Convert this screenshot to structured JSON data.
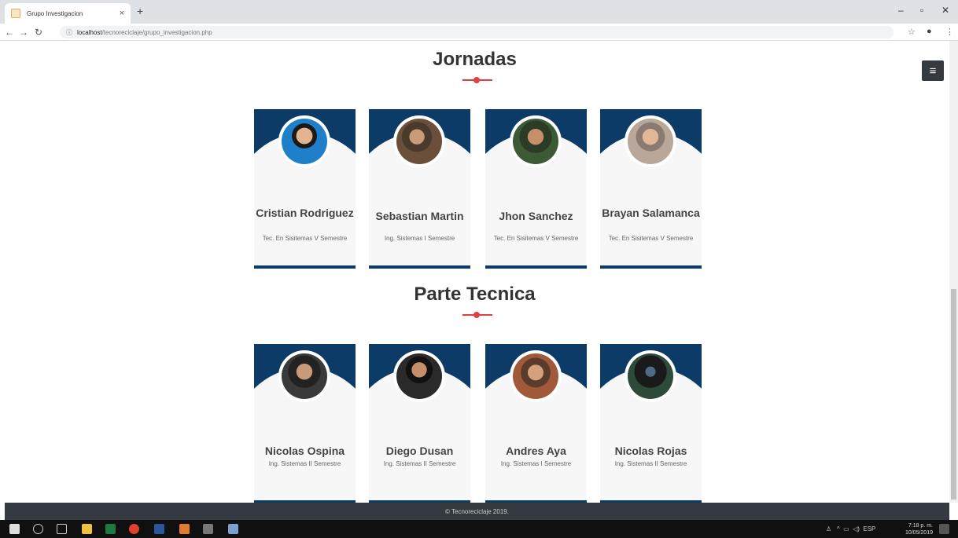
{
  "browser": {
    "tab_title": "Grupo Investigacion",
    "tab_close": "×",
    "new_tab": "+",
    "url_host": "localhost",
    "url_path": "/tecnoreciclaje/grupo_investigacion.php",
    "win_min": "–",
    "win_max": "▫",
    "win_close": "✕"
  },
  "sections": [
    {
      "title": "Jornadas",
      "members": [
        {
          "name": "Cristian Rodriguez",
          "role": "Tec. En Sisitemas V Semestre",
          "photo_color": "#1f7fc9"
        },
        {
          "name": "Sebastian Martin",
          "role": "Ing. Sistemas I Semestre",
          "photo_color": "#6a4f3a"
        },
        {
          "name": "Jhon Sanchez",
          "role": "Tec. En Sisitemas V Semestre",
          "photo_color": "#3c5a34"
        },
        {
          "name": "Brayan Salamanca",
          "role": "Tec. En Sisitemas V Semestre",
          "photo_color": "#b9a79a"
        }
      ]
    },
    {
      "title": "Parte Tecnica",
      "members": [
        {
          "name": "Nicolas Ospina",
          "role": "Ing. Sistemas II Semestre",
          "photo_color": "#3a3a3a"
        },
        {
          "name": "Diego Dusan",
          "role": "Ing. Sistemas II Semestre",
          "photo_color": "#2a2a2a"
        },
        {
          "name": "Andres Aya",
          "role": "Ing. Sistemas I Semestre",
          "photo_color": "#a05a3a"
        },
        {
          "name": "Nicolas Rojas",
          "role": "Ing. Sistemas II Semestre",
          "photo_color": "#2d4a3a"
        }
      ]
    }
  ],
  "footer": {
    "text": "© Tecnoreciclaje 2019."
  },
  "taskbar": {
    "time": "7:18 p. m.",
    "date": "10/05/2019",
    "lang": "ESP"
  },
  "colors": {
    "accent": "#0b3b66",
    "divider": "#e04040",
    "footer_bg": "#343a40"
  }
}
